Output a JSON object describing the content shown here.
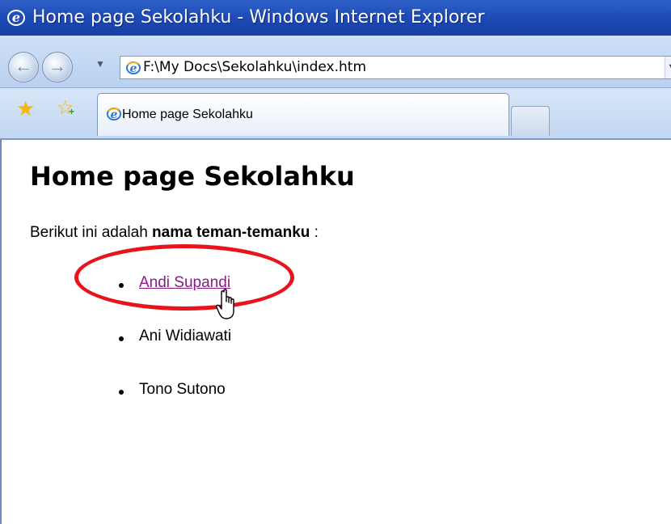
{
  "window": {
    "title": "Home page Sekolahku - Windows Internet Explorer"
  },
  "navigation": {
    "back_icon": "back-arrow-icon",
    "forward_icon": "forward-arrow-icon",
    "address": "F:\\My Docs\\Sekolahku\\index.htm"
  },
  "tabs": [
    {
      "label": "Home page Sekolahku",
      "active": true
    }
  ],
  "page": {
    "heading": "Home page Sekolahku",
    "intro_prefix": "Berikut ini adalah ",
    "intro_bold": "nama teman-temanku",
    "intro_suffix": " :",
    "friends": [
      {
        "name": "Andi Supandi",
        "is_link": true
      },
      {
        "name": "Ani Widiawati",
        "is_link": false
      },
      {
        "name": "Tono Sutono",
        "is_link": false
      }
    ]
  },
  "colors": {
    "titlebar": "#1e4cb8",
    "visited_link": "#8b188b",
    "annotation": "#e8131b"
  }
}
